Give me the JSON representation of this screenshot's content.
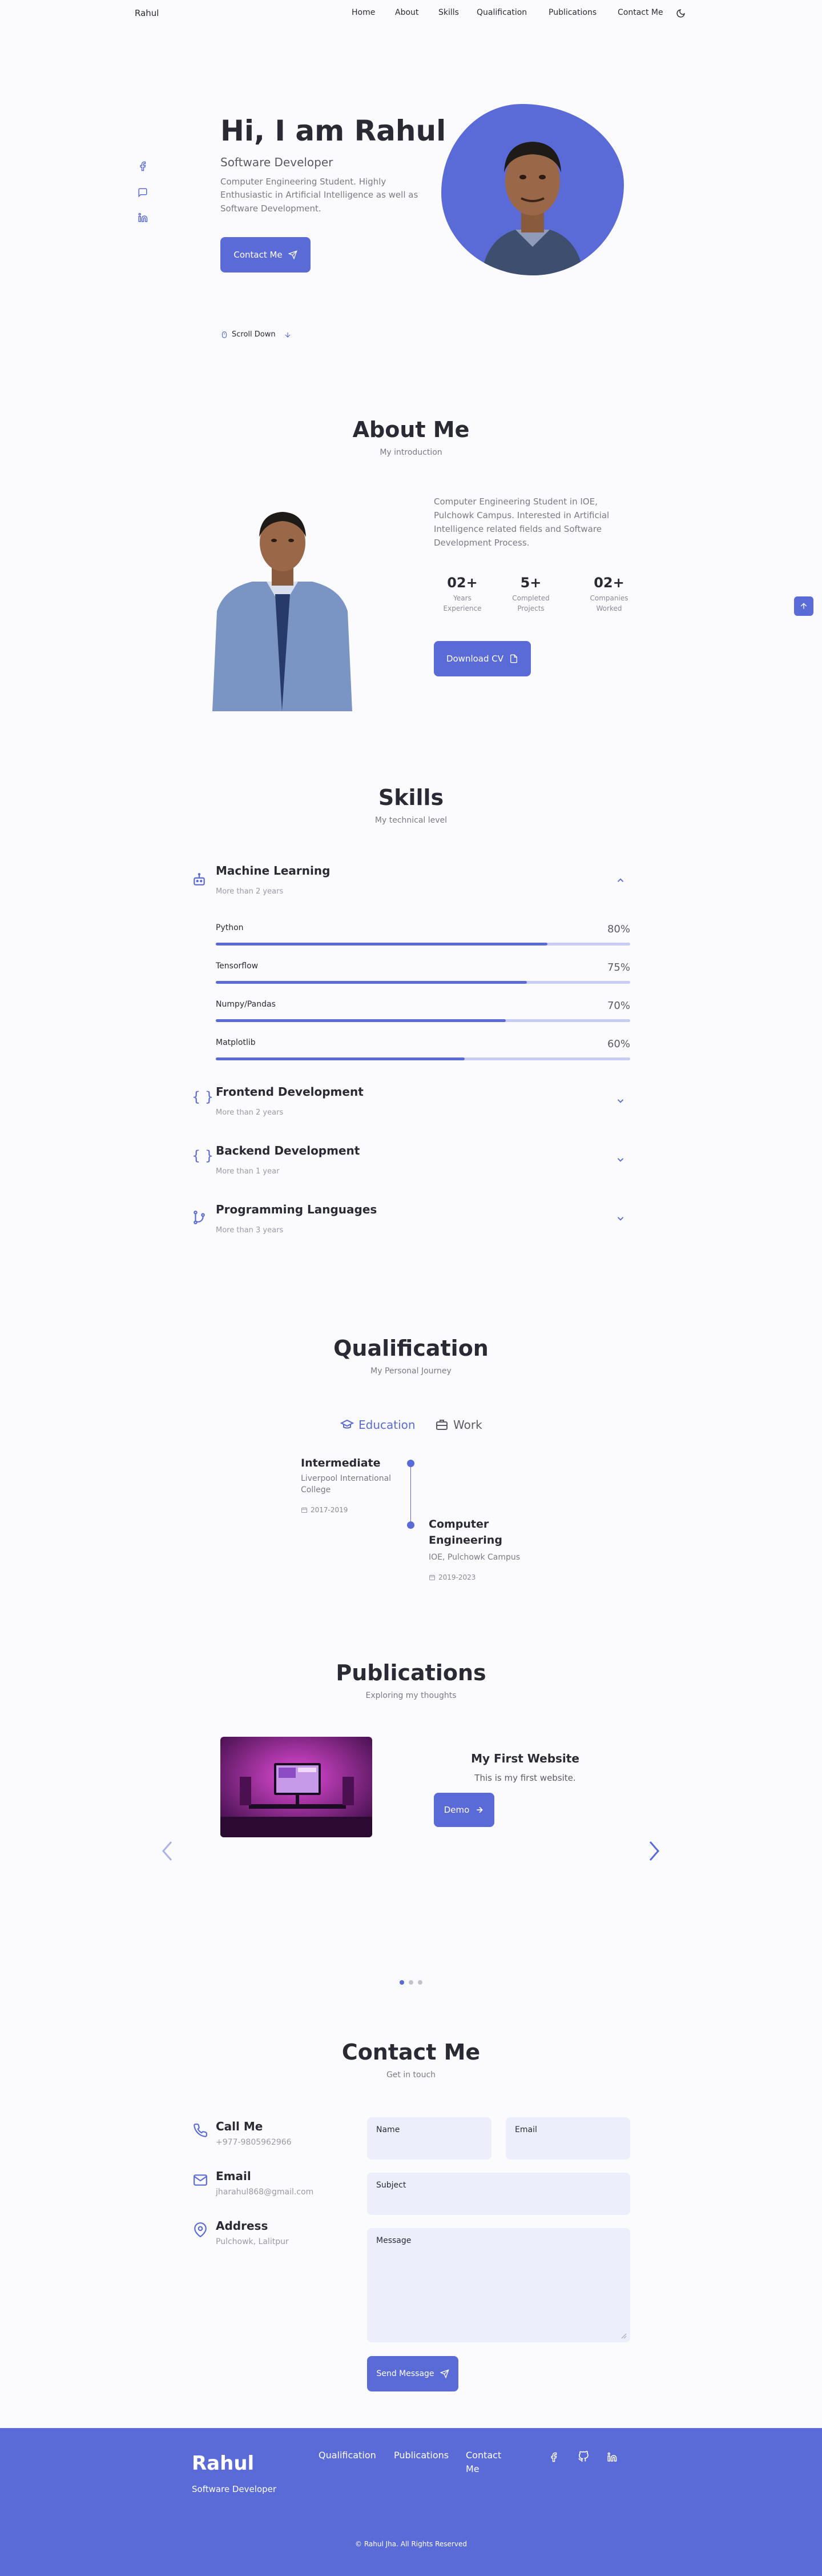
{
  "header": {
    "brand": "Rahul",
    "nav": [
      "Home",
      "Skills",
      "Qualification",
      "Publications",
      "Contact Me"
    ],
    "about": "About"
  },
  "hero": {
    "title": "Hi, I am Rahul",
    "subtitle": "Software Developer",
    "description": "Computer Engineering Student. Highly Enthusiastic in Artificial Intelligence as well as Software Development.",
    "cta": "Contact Me",
    "scroll": "Scroll Down"
  },
  "about": {
    "title": "About Me",
    "subtitle": "My introduction",
    "description": "Computer Engineering Student in IOE, Pulchowk Campus. Interested in Artificial Intelligence related fields and Software Development Process.",
    "stats": [
      {
        "value": "02+",
        "line1": "Years",
        "line2": "Experience"
      },
      {
        "value": "5+",
        "line1": "Completed",
        "line2": "Projects"
      },
      {
        "value": "02+",
        "line1": "Companies",
        "line2": "Worked"
      }
    ],
    "cv_button": "Download CV"
  },
  "skills": {
    "title": "Skills",
    "subtitle": "My technical level",
    "open_category": {
      "title": "Machine Learning",
      "sub": "More than 2 years"
    },
    "items": [
      {
        "name": "Python",
        "pct_label": "80%",
        "pct": 80
      },
      {
        "name": "Tensorflow",
        "pct_label": "75%",
        "pct": 75
      },
      {
        "name": "Numpy/Pandas",
        "pct_label": "70%",
        "pct": 70
      },
      {
        "name": "Matplotlib",
        "pct_label": "60%",
        "pct": 60
      }
    ],
    "categories": [
      {
        "title": "Frontend Development",
        "sub": "More than 2 years"
      },
      {
        "title": "Backend Development",
        "sub": "More than 1 year"
      },
      {
        "title": "Programming Languages",
        "sub": "More than 3 years"
      }
    ]
  },
  "qualification": {
    "title": "Qualification",
    "subtitle": "My Personal Journey",
    "tabs": [
      "Education",
      "Work"
    ],
    "entries": [
      {
        "title": "Intermediate",
        "place1": "Liverpool International",
        "place2": "College",
        "date": "2017-2019"
      },
      {
        "title1": "Computer",
        "title2": "Engineering",
        "place": "IOE, Pulchowk Campus",
        "date": "2019-2023"
      }
    ]
  },
  "publications": {
    "title": "Publications",
    "subtitle": "Exploring my thoughts",
    "item": {
      "title": "My First Website",
      "description": "This is my first website.",
      "button": "Demo"
    }
  },
  "contact": {
    "title": "Contact Me",
    "subtitle": "Get in touch",
    "info": [
      {
        "title": "Call Me",
        "value": "+977-9805962966"
      },
      {
        "title": "Email",
        "value": "jharahul868@gmail.com"
      },
      {
        "title": "Address",
        "value": "Pulchowk, Lalitpur"
      }
    ],
    "form": {
      "name": "Name",
      "email": "Email",
      "subject": "Subject",
      "message": "Message",
      "button": "Send Message"
    }
  },
  "footer": {
    "brand": "Rahul",
    "role": "Software Developer",
    "links": [
      "Qualification",
      "Publications"
    ],
    "contact_line1": "Contact",
    "contact_line2": "Me",
    "copyright": "© Rahul Jha. All Rights Reserved"
  },
  "colors": {
    "accent": "#5a6bd8",
    "background": "#fbfbfe"
  }
}
